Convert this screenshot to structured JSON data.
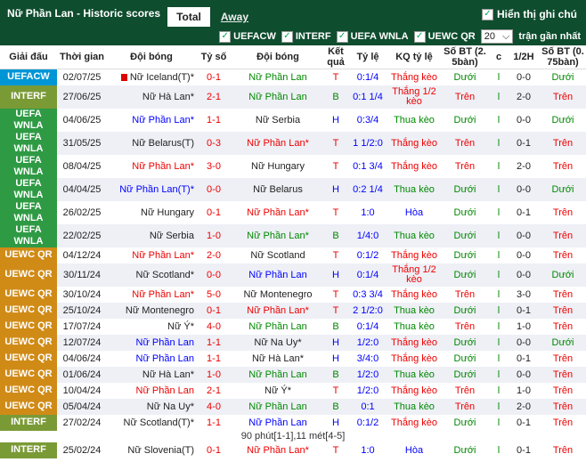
{
  "header": {
    "title": "Nữ Phần Lan - Historic scores",
    "tabs": [
      {
        "label": "Total"
      },
      {
        "label": "Away"
      }
    ],
    "show_notes_label": "Hiển thị ghi chú"
  },
  "filters": {
    "items": [
      {
        "label": "UEFACW"
      },
      {
        "label": "INTERF"
      },
      {
        "label": "UEFA WNLA"
      },
      {
        "label": "UEWC QR"
      }
    ],
    "count_value": "20",
    "recent_label": "trận gần nhất"
  },
  "columns": {
    "comp": "Giải đấu",
    "date": "Thời gian",
    "home": "Đội bóng",
    "score": "Tỷ số",
    "away": "Đội bóng",
    "result": "Kết quả",
    "hcap": "Tỷ lệ",
    "hcap_res": "KQ tỷ lệ",
    "ou": "Số BT (2. 5bàn)",
    "ht_flag": "c",
    "ht": "1/2H",
    "ou2": "Số BT (0. 75bàn)"
  },
  "rows": [
    {
      "comp": "UEFACW",
      "cc": "uefacw",
      "date": "02/07/25",
      "home": "Nữ Iceland(T)*",
      "hc": "",
      "score": "0-1",
      "away": "Nữ Phần Lan",
      "ac": "green",
      "res": "T",
      "rc": "red",
      "hcap": "0:1/4",
      "hr": "Thắng kèo",
      "hrc": "red",
      "ou": "Dưới",
      "oc": "green",
      "hf": "l",
      "ht": "0-0",
      "ou2": "Dưới",
      "o2c": "green",
      "flag": true
    },
    {
      "comp": "INTERF",
      "cc": "interf",
      "date": "27/06/25",
      "home": "Nữ Hà Lan*",
      "hc": "",
      "score": "2-1",
      "away": "Nữ Phần Lan",
      "ac": "green",
      "res": "B",
      "rc": "green",
      "hcap": "0:1 1/4",
      "hr": "Thắng 1/2 kèo",
      "hrc": "red",
      "ou": "Trên",
      "oc": "red",
      "hf": "l",
      "ht": "2-0",
      "ou2": "Trên",
      "o2c": "red",
      "wrap": true
    },
    {
      "comp": "UEFA WNLA",
      "cc": "wnla",
      "date": "04/06/25",
      "home": "Nữ Phần Lan*",
      "hc": "blue",
      "score": "1-1",
      "away": "Nữ Serbia",
      "ac": "",
      "res": "H",
      "rc": "blue",
      "hcap": "0:3/4",
      "hr": "Thua kèo",
      "hrc": "green",
      "ou": "Dưới",
      "oc": "green",
      "hf": "l",
      "ht": "0-0",
      "ou2": "Dưới",
      "o2c": "green"
    },
    {
      "comp": "UEFA WNLA",
      "cc": "wnla",
      "date": "31/05/25",
      "home": "Nữ Belarus(T)",
      "hc": "",
      "score": "0-3",
      "away": "Nữ Phần Lan*",
      "ac": "red",
      "res": "T",
      "rc": "red",
      "hcap": "1 1/2:0",
      "hr": "Thắng kèo",
      "hrc": "red",
      "ou": "Trên",
      "oc": "red",
      "hf": "l",
      "ht": "0-1",
      "ou2": "Trên",
      "o2c": "red"
    },
    {
      "comp": "UEFA WNLA",
      "cc": "wnla",
      "date": "08/04/25",
      "home": "Nữ Phần Lan*",
      "hc": "red",
      "score": "3-0",
      "away": "Nữ Hungary",
      "ac": "",
      "res": "T",
      "rc": "red",
      "hcap": "0:1 3/4",
      "hr": "Thắng kèo",
      "hrc": "red",
      "ou": "Trên",
      "oc": "red",
      "hf": "l",
      "ht": "2-0",
      "ou2": "Trên",
      "o2c": "red"
    },
    {
      "comp": "UEFA WNLA",
      "cc": "wnla",
      "date": "04/04/25",
      "home": "Nữ Phần Lan(T)*",
      "hc": "blue",
      "score": "0-0",
      "away": "Nữ Belarus",
      "ac": "",
      "res": "H",
      "rc": "blue",
      "hcap": "0:2 1/4",
      "hr": "Thua kèo",
      "hrc": "green",
      "ou": "Dưới",
      "oc": "green",
      "hf": "l",
      "ht": "0-0",
      "ou2": "Dưới",
      "o2c": "green"
    },
    {
      "comp": "UEFA WNLA",
      "cc": "wnla",
      "date": "26/02/25",
      "home": "Nữ Hungary",
      "hc": "",
      "score": "0-1",
      "away": "Nữ Phần Lan*",
      "ac": "red",
      "res": "T",
      "rc": "red",
      "hcap": "1:0",
      "hr": "Hòa",
      "hrc": "blue",
      "ou": "Dưới",
      "oc": "green",
      "hf": "l",
      "ht": "0-1",
      "ou2": "Trên",
      "o2c": "red"
    },
    {
      "comp": "UEFA WNLA",
      "cc": "wnla",
      "date": "22/02/25",
      "home": "Nữ Serbia",
      "hc": "",
      "score": "1-0",
      "away": "Nữ Phần Lan*",
      "ac": "green",
      "res": "B",
      "rc": "green",
      "hcap": "1/4:0",
      "hr": "Thua kèo",
      "hrc": "green",
      "ou": "Dưới",
      "oc": "green",
      "hf": "l",
      "ht": "0-0",
      "ou2": "Trên",
      "o2c": "red"
    },
    {
      "comp": "UEWC QR",
      "cc": "uewc",
      "date": "04/12/24",
      "home": "Nữ Phần Lan*",
      "hc": "red",
      "score": "2-0",
      "away": "Nữ Scotland",
      "ac": "",
      "res": "T",
      "rc": "red",
      "hcap": "0:1/2",
      "hr": "Thắng kèo",
      "hrc": "red",
      "ou": "Dưới",
      "oc": "green",
      "hf": "l",
      "ht": "0-0",
      "ou2": "Trên",
      "o2c": "red"
    },
    {
      "comp": "UEWC QR",
      "cc": "uewc",
      "date": "30/11/24",
      "home": "Nữ Scotland*",
      "hc": "",
      "score": "0-0",
      "away": "Nữ Phần Lan",
      "ac": "blue",
      "res": "H",
      "rc": "blue",
      "hcap": "0:1/4",
      "hr": "Thắng 1/2 kèo",
      "hrc": "red",
      "ou": "Dưới",
      "oc": "green",
      "hf": "l",
      "ht": "0-0",
      "ou2": "Dưới",
      "o2c": "green",
      "wrap": true
    },
    {
      "comp": "UEWC QR",
      "cc": "uewc",
      "date": "30/10/24",
      "home": "Nữ Phần Lan*",
      "hc": "red",
      "score": "5-0",
      "away": "Nữ Montenegro",
      "ac": "",
      "res": "T",
      "rc": "red",
      "hcap": "0:3 3/4",
      "hr": "Thắng kèo",
      "hrc": "red",
      "ou": "Trên",
      "oc": "red",
      "hf": "l",
      "ht": "3-0",
      "ou2": "Trên",
      "o2c": "red"
    },
    {
      "comp": "UEWC QR",
      "cc": "uewc",
      "date": "25/10/24",
      "home": "Nữ Montenegro",
      "hc": "",
      "score": "0-1",
      "away": "Nữ Phần Lan*",
      "ac": "red",
      "res": "T",
      "rc": "red",
      "hcap": "2 1/2:0",
      "hr": "Thua kèo",
      "hrc": "green",
      "ou": "Dưới",
      "oc": "green",
      "hf": "l",
      "ht": "0-1",
      "ou2": "Trên",
      "o2c": "red"
    },
    {
      "comp": "UEWC QR",
      "cc": "uewc",
      "date": "17/07/24",
      "home": "Nữ Ý*",
      "hc": "",
      "score": "4-0",
      "away": "Nữ Phần Lan",
      "ac": "green",
      "res": "B",
      "rc": "green",
      "hcap": "0:1/4",
      "hr": "Thua kèo",
      "hrc": "green",
      "ou": "Trên",
      "oc": "red",
      "hf": "l",
      "ht": "1-0",
      "ou2": "Trên",
      "o2c": "red"
    },
    {
      "comp": "UEWC QR",
      "cc": "uewc",
      "date": "12/07/24",
      "home": "Nữ Phần Lan",
      "hc": "blue",
      "score": "1-1",
      "away": "Nữ Na Uy*",
      "ac": "",
      "res": "H",
      "rc": "blue",
      "hcap": "1/2:0",
      "hr": "Thắng kèo",
      "hrc": "red",
      "ou": "Dưới",
      "oc": "green",
      "hf": "l",
      "ht": "0-0",
      "ou2": "Dưới",
      "o2c": "green"
    },
    {
      "comp": "UEWC QR",
      "cc": "uewc",
      "date": "04/06/24",
      "home": "Nữ Phần Lan",
      "hc": "blue",
      "score": "1-1",
      "away": "Nữ Hà Lan*",
      "ac": "",
      "res": "H",
      "rc": "blue",
      "hcap": "3/4:0",
      "hr": "Thắng kèo",
      "hrc": "red",
      "ou": "Dưới",
      "oc": "green",
      "hf": "l",
      "ht": "0-1",
      "ou2": "Trên",
      "o2c": "red"
    },
    {
      "comp": "UEWC QR",
      "cc": "uewc",
      "date": "01/06/24",
      "home": "Nữ Hà Lan*",
      "hc": "",
      "score": "1-0",
      "away": "Nữ Phần Lan",
      "ac": "green",
      "res": "B",
      "rc": "green",
      "hcap": "1/2:0",
      "hr": "Thua kèo",
      "hrc": "green",
      "ou": "Dưới",
      "oc": "green",
      "hf": "l",
      "ht": "0-0",
      "ou2": "Trên",
      "o2c": "red"
    },
    {
      "comp": "UEWC QR",
      "cc": "uewc",
      "date": "10/04/24",
      "home": "Nữ Phần Lan",
      "hc": "red",
      "score": "2-1",
      "away": "Nữ Ý*",
      "ac": "",
      "res": "T",
      "rc": "red",
      "hcap": "1/2:0",
      "hr": "Thắng kèo",
      "hrc": "red",
      "ou": "Trên",
      "oc": "red",
      "hf": "l",
      "ht": "1-0",
      "ou2": "Trên",
      "o2c": "red"
    },
    {
      "comp": "UEWC QR",
      "cc": "uewc",
      "date": "05/04/24",
      "home": "Nữ Na Uy*",
      "hc": "",
      "score": "4-0",
      "away": "Nữ Phần Lan",
      "ac": "green",
      "res": "B",
      "rc": "green",
      "hcap": "0:1",
      "hr": "Thua kèo",
      "hrc": "green",
      "ou": "Trên",
      "oc": "red",
      "hf": "l",
      "ht": "2-0",
      "ou2": "Trên",
      "o2c": "red"
    },
    {
      "comp": "INTERF",
      "cc": "interf",
      "date": "27/02/24",
      "home": "Nữ Scotland(T)*",
      "hc": "",
      "score": "1-1",
      "away": "Nữ Phần Lan",
      "ac": "blue",
      "res": "H",
      "rc": "blue",
      "hcap": "0:1/2",
      "hr": "Thắng kèo",
      "hrc": "red",
      "ou": "Dưới",
      "oc": "green",
      "hf": "l",
      "ht": "0-1",
      "ou2": "Trên",
      "o2c": "red"
    }
  ],
  "note": "90 phút[1-1],11 mét[4-5]",
  "last_row": {
    "comp": "INTERF",
    "cc": "interf",
    "date": "25/02/24",
    "home": "Nữ Slovenia(T)",
    "hc": "",
    "score": "0-1",
    "away": "Nữ Phần Lan*",
    "ac": "red",
    "res": "T",
    "rc": "red",
    "hcap": "1:0",
    "hr": "Hòa",
    "hrc": "blue",
    "ou": "Dưới",
    "oc": "green",
    "hf": "l",
    "ht": "0-1",
    "ou2": "Trên",
    "o2c": "red"
  }
}
